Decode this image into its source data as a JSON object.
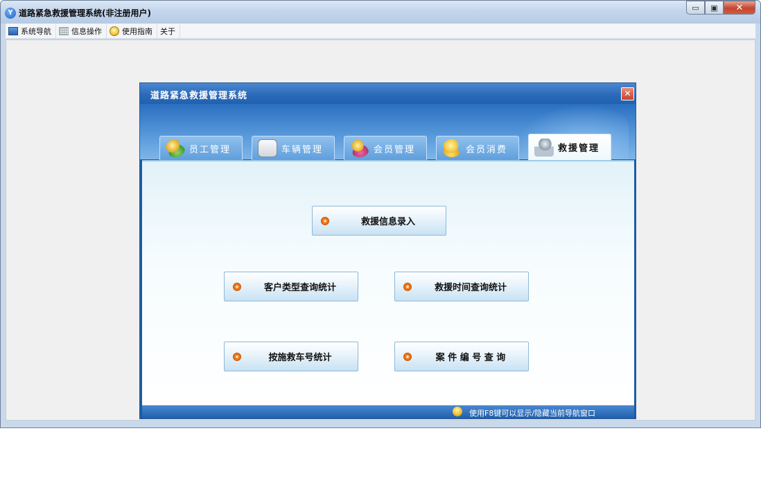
{
  "window": {
    "title": "道路紧急救援管理系统(非注册用户)",
    "icon": "app-logo-icon",
    "buttons": {
      "minimize": "▭",
      "restore": "▣",
      "close": "✕"
    }
  },
  "menubar": [
    {
      "label": "系统导航",
      "icon": "monitor-icon"
    },
    {
      "label": "信息操作",
      "icon": "grid-icon"
    },
    {
      "label": "使用指南",
      "icon": "help-icon"
    },
    {
      "label": "关于",
      "icon": ""
    }
  ],
  "dialog": {
    "title": "道路紧急救援管理系统",
    "close": "✕",
    "tabs": [
      {
        "label": "员工管理",
        "icon": "staff-icon",
        "active": false
      },
      {
        "label": "车辆管理",
        "icon": "vehicle-icon",
        "active": false
      },
      {
        "label": "会员管理",
        "icon": "member-icon",
        "active": false
      },
      {
        "label": "会员消费",
        "icon": "consume-icon",
        "active": false
      },
      {
        "label": "救援管理",
        "icon": "rescue-icon",
        "active": true
      }
    ],
    "actions": {
      "rescue_entry": "救援信息录入",
      "customer_type_stats": "客户类型查询统计",
      "rescue_time_stats": "救援时间查询统计",
      "vehicle_no_stats": "按施救车号统计",
      "case_no_query": "案 件 编 号 查 询"
    },
    "status": "使用F8键可以显示/隐藏当前导航窗口"
  }
}
